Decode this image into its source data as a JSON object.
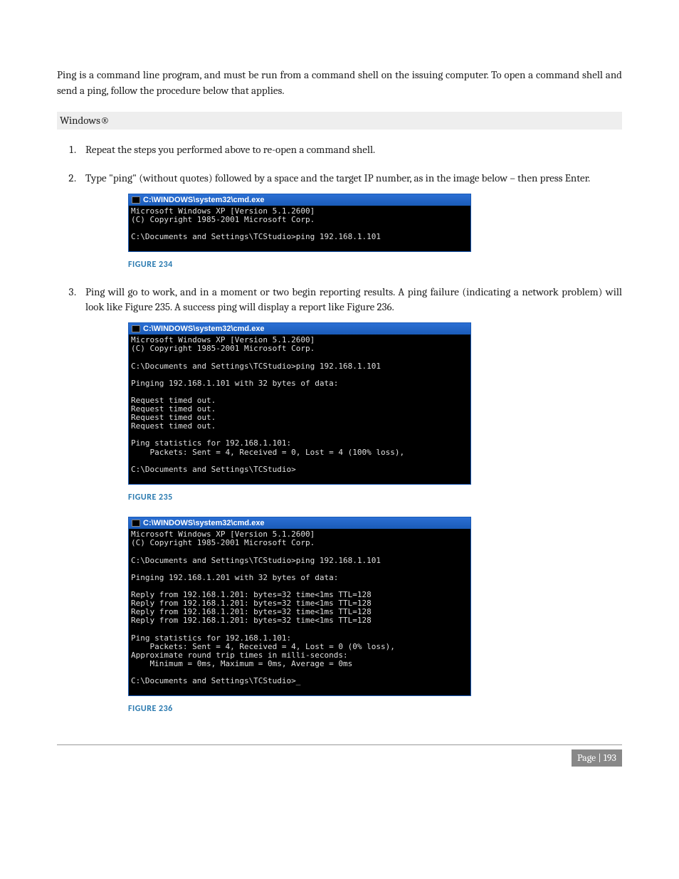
{
  "intro": "Ping is a command line program, and must be run from a command shell on the issuing computer. To open a command shell and send a ping, follow the procedure below that applies.",
  "heading_windows": "Windows®",
  "steps": {
    "s1": "Repeat the steps you performed above to re-open a command shell.",
    "s2": "Type \"ping\" (without quotes) followed by a space and the target IP number, as in the image below – then press Enter.",
    "s3": "Ping will go to work, and in a moment or two begin reporting results.  A ping failure (indicating a network problem) will look like Figure 235.  A success ping will display a report like Figure 236."
  },
  "figures": {
    "f234": {
      "caption": "FIGURE 234",
      "title": "C:\\WINDOWS\\system32\\cmd.exe",
      "body": "Microsoft Windows XP [Version 5.1.2600]\n(C) Copyright 1985-2001 Microsoft Corp.\n\nC:\\Documents and Settings\\TCStudio>ping 192.168.1.101\n\n"
    },
    "f235": {
      "caption": "FIGURE 235",
      "title": "C:\\WINDOWS\\system32\\cmd.exe",
      "body": "Microsoft Windows XP [Version 5.1.2600]\n(C) Copyright 1985-2001 Microsoft Corp.\n\nC:\\Documents and Settings\\TCStudio>ping 192.168.1.101\n\nPinging 192.168.1.101 with 32 bytes of data:\n\nRequest timed out.\nRequest timed out.\nRequest timed out.\nRequest timed out.\n\nPing statistics for 192.168.1.101:\n    Packets: Sent = 4, Received = 0, Lost = 4 (100% loss),\n\nC:\\Documents and Settings\\TCStudio>\n\n"
    },
    "f236": {
      "caption": "FIGURE 236",
      "title": "C:\\WINDOWS\\system32\\cmd.exe",
      "body": "Microsoft Windows XP [Version 5.1.2600]\n(C) Copyright 1985-2001 Microsoft Corp.\n\nC:\\Documents and Settings\\TCStudio>ping 192.168.1.101\n\nPinging 192.168.1.201 with 32 bytes of data:\n\nReply from 192.168.1.201: bytes=32 time<1ms TTL=128\nReply from 192.168.1.201: bytes=32 time<1ms TTL=128\nReply from 192.168.1.201: bytes=32 time<1ms TTL=128\nReply from 192.168.1.201: bytes=32 time<1ms TTL=128\n\nPing statistics for 192.168.1.101:\n    Packets: Sent = 4, Received = 4, Lost = 0 (0% loss),\nApproximate round trip times in milli-seconds:\n    Minimum = 0ms, Maximum = 0ms, Average = 0ms\n\nC:\\Documents and Settings\\TCStudio>_\n\n"
    }
  },
  "footer": {
    "page_label": "Page | 193"
  }
}
